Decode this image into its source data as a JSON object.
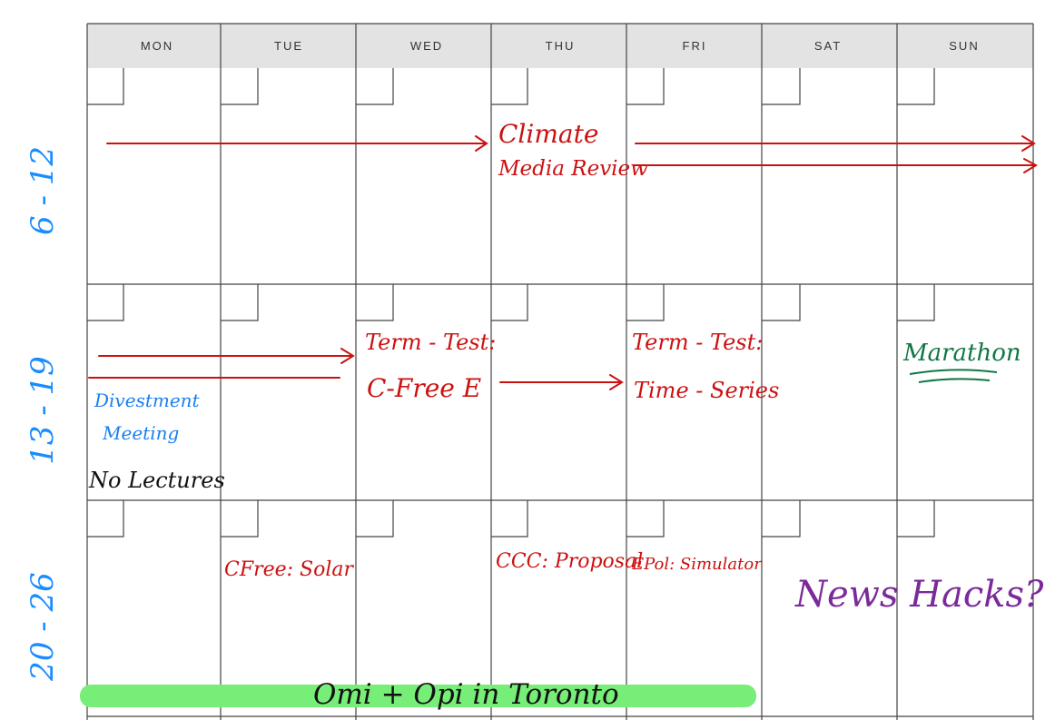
{
  "weekdays": [
    "MON",
    "TUE",
    "WED",
    "THU",
    "FRI",
    "SAT",
    "SUN"
  ],
  "weeks": [
    {
      "range": "6 - 12"
    },
    {
      "range": "13 - 19"
    },
    {
      "range": "20 - 26"
    }
  ],
  "notes": {
    "climate": [
      "Climate",
      "Media Review"
    ],
    "term_test_1": [
      "Term - Test:",
      "C-Free E"
    ],
    "term_test_2": [
      "Term - Test:",
      "Time - Series"
    ],
    "marathon": "Marathon",
    "divestment": [
      "Divestment",
      "Meeting"
    ],
    "no_lectures": "No Lectures",
    "cfree_solar": "CFree: Solar",
    "ccc_proposal": "CCC: Proposal",
    "epol_simulator": "EPol: Simulator",
    "news_hacks": "News Hacks?",
    "toronto": "Omi + Opi in Toronto"
  },
  "colors": {
    "header_bg": "#e3e3e3",
    "grid": "#444444",
    "week_label": "#1a8cff",
    "red": "#cc1111",
    "blue": "#1a7ff0",
    "green": "#117744",
    "purple": "#7a2a9a",
    "highlight": "#77ee77",
    "black": "#111111"
  }
}
